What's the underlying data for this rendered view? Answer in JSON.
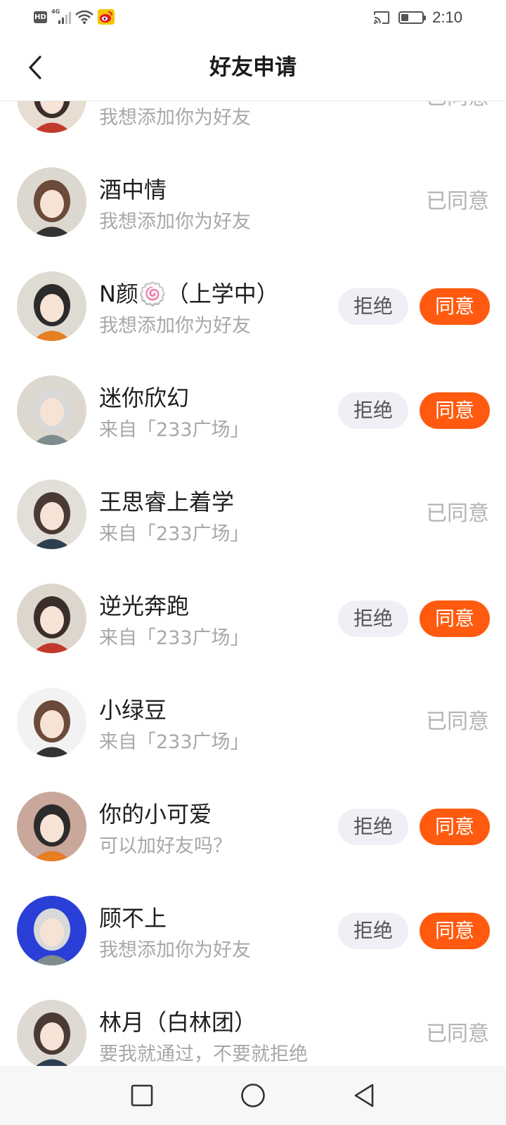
{
  "status_bar": {
    "hd": "HD",
    "network": "4G",
    "time": "2:10",
    "battery_level": 0.35,
    "icons": [
      "hd-icon",
      "signal-icon",
      "wifi-icon",
      "weibo-icon",
      "cast-icon",
      "battery-icon"
    ]
  },
  "header": {
    "title": "好友申请",
    "back_icon": "chevron-left-icon"
  },
  "labels": {
    "reject": "拒绝",
    "accept": "同意",
    "agreed": "已同意"
  },
  "requests": [
    {
      "name": "",
      "message": "我想添加你为好友",
      "status": "agreed",
      "status_text": "已同意",
      "avatar_bg": "#e7ddd0"
    },
    {
      "name": "酒中情",
      "message": "我想添加你为好友",
      "status": "agreed",
      "status_text": "已同意",
      "avatar_bg": "#dcd8cf"
    },
    {
      "name": "N颜🍥（上学中）",
      "message": "我想添加你为好友",
      "status": "pending",
      "avatar_bg": "#dedbd2"
    },
    {
      "name": "迷你欣幻",
      "message": "来自「233广场」",
      "status": "pending",
      "avatar_bg": "#ddd8cf"
    },
    {
      "name": "王思睿上着学",
      "message": "来自「233广场」",
      "status": "agreed",
      "status_text": "已同意",
      "avatar_bg": "#e2dfd8"
    },
    {
      "name": "逆光奔跑",
      "message": "来自「233广场」",
      "status": "pending",
      "avatar_bg": "#dcd6cc"
    },
    {
      "name": "小绿豆",
      "message": "来自「233广场」",
      "status": "agreed",
      "status_text": "已同意",
      "avatar_bg": "#f2f2f2"
    },
    {
      "name": "你的小可爱",
      "message": "可以加好友吗？",
      "status": "pending",
      "avatar_bg": "#c9a79a"
    },
    {
      "name": "顾不上",
      "message": "我想添加你为好友",
      "status": "pending",
      "avatar_bg": "#2a3fd8"
    },
    {
      "name": "林月（白林团）",
      "message": "要我就通过，不要就拒绝",
      "status": "agreed",
      "status_text": "已同意",
      "avatar_bg": "#dedad3"
    }
  ],
  "nav_bar": {
    "icons": [
      "square-recents-icon",
      "circle-home-icon",
      "triangle-back-icon"
    ]
  },
  "colors": {
    "accent": "#ff5a0f",
    "reject_bg": "#eef0f5",
    "muted_text": "#a8a8a8"
  }
}
